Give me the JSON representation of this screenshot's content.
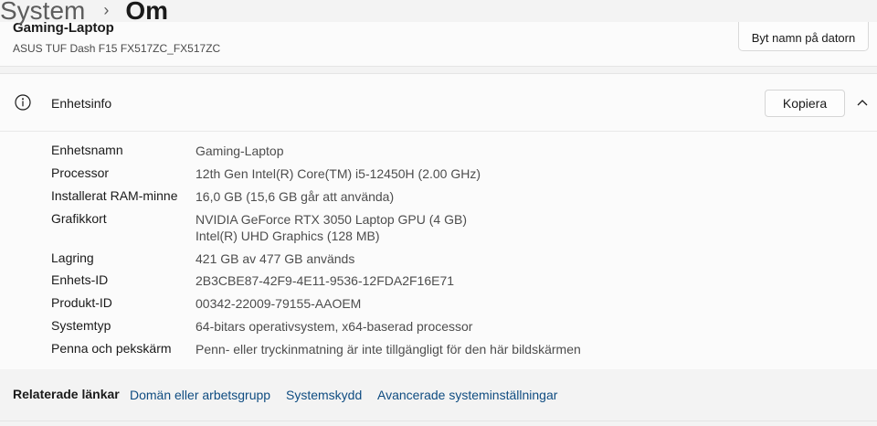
{
  "breadcrumb": {
    "parent": "System",
    "separator": "›",
    "current": "Om"
  },
  "device": {
    "name": "Gaming-Laptop",
    "model": "ASUS TUF Dash F15 FX517ZC_FX517ZC",
    "rename_label": "Byt namn på datorn"
  },
  "device_info": {
    "title": "Enhetsinfo",
    "copy_label": "Kopiera",
    "specs": [
      {
        "label": "Enhetsnamn",
        "value": "Gaming-Laptop"
      },
      {
        "label": "Processor",
        "value": "12th Gen Intel(R) Core(TM) i5-12450H (2.00 GHz)"
      },
      {
        "label": "Installerat RAM-minne",
        "value": "16,0 GB (15,6 GB går att använda)"
      },
      {
        "label": "Grafikkort",
        "value": "NVIDIA GeForce RTX 3050 Laptop GPU (4 GB)",
        "value2": "Intel(R) UHD Graphics (128 MB)"
      },
      {
        "label": "Lagring",
        "value": "421 GB av 477 GB används"
      },
      {
        "label": "Enhets-ID",
        "value": "2B3CBE87-42F9-4E11-9536-12FDA2F16E71"
      },
      {
        "label": "Produkt-ID",
        "value": "00342-22009-79155-AAOEM"
      },
      {
        "label": "Systemtyp",
        "value": "64-bitars operativsystem, x64-baserad processor"
      },
      {
        "label": "Penna och pekskärm",
        "value": "Penn- eller tryckinmatning är inte tillgängligt för den här bildskärmen"
      }
    ]
  },
  "related_links": {
    "title": "Relaterade länkar",
    "links": [
      "Domän eller arbetsgrupp",
      "Systemskydd",
      "Avancerade systeminställningar"
    ]
  },
  "icons": {
    "info": "info-icon",
    "collapse": "chevron-up-icon"
  },
  "colors": {
    "link": "#0f4c81",
    "card": "#fbfbfb",
    "background": "#f3f3f3"
  }
}
